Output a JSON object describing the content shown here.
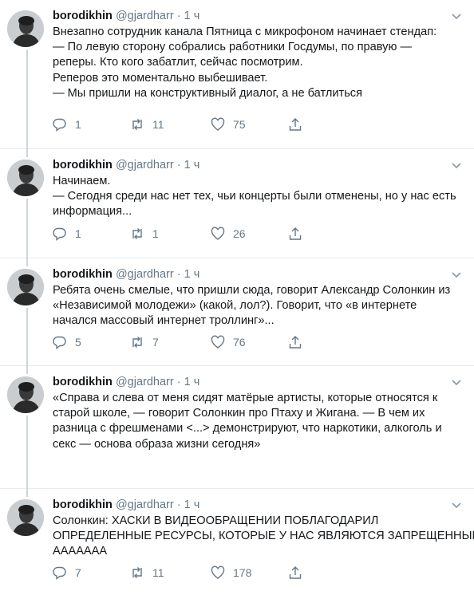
{
  "tweets": [
    {
      "name": "borodikhin",
      "handle": "@gjardharr",
      "dot": "·",
      "time": "1 ч",
      "lines": [
        "Внезапно сотрудник канала Пятница с микрофоном начинает стендап:",
        "— По левую сторону собрались работники Госдумы, по правую —",
        "реперы. Кто кого забатлит, сейчас посмотрим.",
        "Реперов это моментально выбешивает.",
        "— Мы пришли на конструктивный диалог, а не батлиться"
      ],
      "replies": "1",
      "retweets": "11",
      "likes": "75"
    },
    {
      "name": "borodikhin",
      "handle": "@gjardharr",
      "dot": "·",
      "time": "1 ч",
      "lines": [
        "Начинаем.",
        "— Сегодня среди нас нет тех, чьи концерты были отменены, но у нас есть",
        "информация..."
      ],
      "replies": "1",
      "retweets": "1",
      "likes": "26"
    },
    {
      "name": "borodikhin",
      "handle": "@gjardharr",
      "dot": "·",
      "time": "1 ч",
      "lines": [
        "Ребята очень смелые, что пришли сюда, говорит Александр Солонкин из",
        "«Независимой молодежи» (какой, лол?). Говорит, что «в интернете",
        "начался массовый интернет троллинг»..."
      ],
      "replies": "5",
      "retweets": "7",
      "likes": "76"
    },
    {
      "name": "borodikhin",
      "handle": "@gjardharr",
      "dot": "·",
      "time": "1 ч",
      "lines": [
        "«Справа и слева от меня сидят матёрые артисты, которые относятся к",
        "старой школе, — говорит Солонкин про Птаху и Жигана. — В чем их",
        "разница с фрешменами <...> демонстрируют, что наркотики, алкоголь и",
        "секс — основа образа жизни сегодня»"
      ],
      "replies": "1",
      "retweets": "1",
      "likes": "76"
    },
    {
      "name": "borodikhin",
      "handle": "@gjardharr",
      "dot": "·",
      "time": "1 ч",
      "lines": [
        "Солонкин: ХАСКИ В ВИДЕООБРАЩЕНИИ ПОБЛАГОДАРИЛ",
        "ОПРЕДЕЛЕННЫЕ РЕСУРСЫ, КОТОРЫЕ У НАС ЯВЛЯЮТСЯ ЗАПРЕЩЕННЫМИ",
        "АААААAA"
      ],
      "replies": "7",
      "retweets": "11",
      "likes": "178"
    }
  ],
  "icons": {
    "reply": "reply-icon",
    "retweet": "retweet-icon",
    "like": "heart-icon",
    "share": "share-icon",
    "more": "chevron-down-icon"
  },
  "colors": {
    "text": "#14171a",
    "muted": "#657786",
    "divider": "#e6ecf0",
    "thread": "#ccd6dd"
  }
}
